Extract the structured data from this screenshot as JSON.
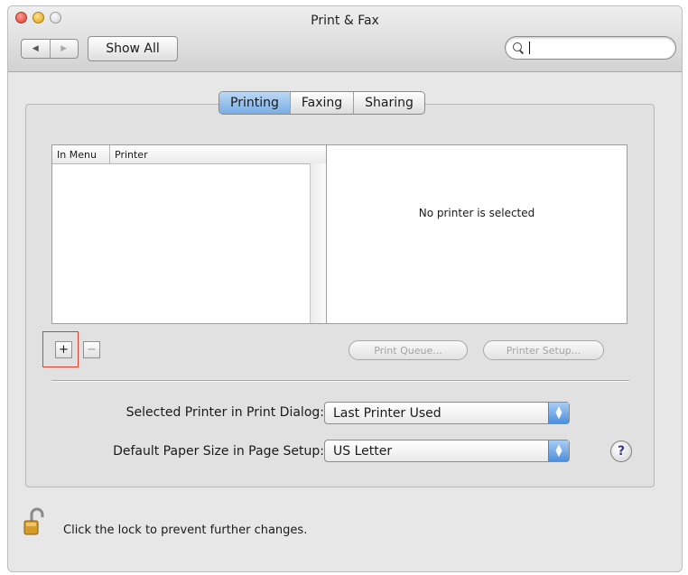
{
  "window": {
    "title": "Print & Fax"
  },
  "toolbar": {
    "back_glyph": "◀",
    "forward_glyph": "▶",
    "show_all_label": "Show All",
    "search": {
      "value": "",
      "placeholder": ""
    }
  },
  "tabs": [
    {
      "label": "Printing",
      "active": true
    },
    {
      "label": "Faxing",
      "active": false
    },
    {
      "label": "Sharing",
      "active": false
    }
  ],
  "printer_list": {
    "columns": [
      "In Menu",
      "Printer"
    ],
    "rows": []
  },
  "detail": {
    "message": "No printer is selected"
  },
  "list_controls": {
    "add_label": "+",
    "remove_label": "−",
    "print_queue_label": "Print Queue...",
    "printer_setup_label": "Printer Setup..."
  },
  "settings": {
    "selected_printer_label": "Selected Printer in Print Dialog:",
    "selected_printer_value": "Last Printer Used",
    "paper_size_label": "Default Paper Size in Page Setup:",
    "paper_size_value": "US Letter",
    "help_label": "?"
  },
  "footer": {
    "lock_text": "Click the lock to prevent further changes."
  },
  "icons": {
    "search": "search-icon",
    "lock": "lock-icon",
    "popup_arrows": "popup-arrows-icon"
  },
  "colors": {
    "tab_active": "#79aee6",
    "popup_accent": "#4b8fde",
    "highlight_box": "#e0412c"
  }
}
